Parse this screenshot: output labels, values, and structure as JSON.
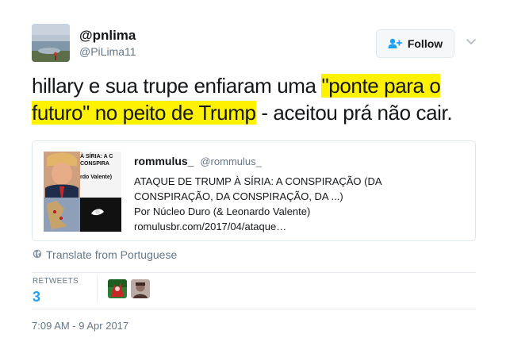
{
  "author": {
    "display_name": "@pnlima",
    "handle": "@PiLima11"
  },
  "follow_button": {
    "label": "Follow",
    "icon": "add-user-icon"
  },
  "tweet": {
    "text_plain_1": "hillary e sua trupe enfiaram uma ",
    "text_highlight_1": "\"ponte para o",
    "text_highlight_2": "futuro\" no peito de Trump",
    "text_plain_2": " - aceitou prá não cair.",
    "highlight_color": "#fff200"
  },
  "card": {
    "name": "rommulus_",
    "username": "@rommulus_",
    "title_line_1": "ATAQUE DE TRUMP À SÍRIA: A CONSPIRAÇÃO (DA",
    "title_line_2": "CONSPIRAÇÃO, DA CONSPIRAÇÃO, DA ...)",
    "byline": "Por Núcleo Duro (& Leonardo Valente)",
    "link": "romulusbr.com/2017/04/ataque…",
    "thumb_caption_1": "À SÍRIA: A C",
    "thumb_caption_2": "CONSPIRA",
    "thumb_caption_3": "rdo Valente)"
  },
  "translate": {
    "label": "Translate from Portuguese",
    "icon": "globe-icon"
  },
  "stats": {
    "retweets_label": "RETWEETS",
    "retweets_count": "3"
  },
  "timestamp": "7:09 AM - 9 Apr 2017",
  "colors": {
    "accent": "#1da1f2",
    "secondary_text": "#657786",
    "border": "#e1e8ed"
  }
}
